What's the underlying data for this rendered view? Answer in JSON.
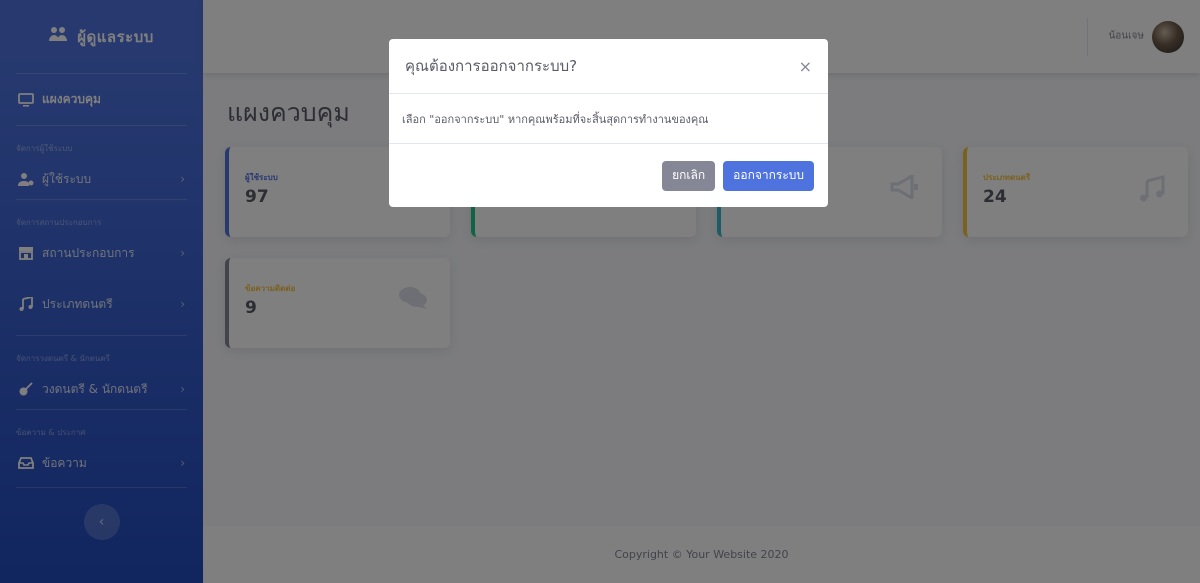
{
  "brand": {
    "icon": "people-icon",
    "label": "ผู้ดูแลระบบ"
  },
  "sidebar": {
    "dashboard": "แผงควบคุม",
    "headings": [
      "จัดการผู้ใช้ระบบ",
      "จัดการสถานประกอบการ",
      "จัดการวงดนตรี & นักดนตรี",
      "ข้อความ & ประกาศ"
    ],
    "items": [
      {
        "label": "ผู้ใช้ระบบ",
        "icon": "user-cog-icon"
      },
      {
        "label": "สถานประกอบการ",
        "icon": "store-icon"
      },
      {
        "label": "ประเภทดนตรี",
        "icon": "music-icon"
      },
      {
        "label": "วงดนตรี & นักดนตรี",
        "icon": "guitar-icon"
      },
      {
        "label": "ข้อความ",
        "icon": "inbox-icon"
      }
    ]
  },
  "topbar": {
    "username": "น้อนเจษ"
  },
  "page": {
    "title": "แผงควบคุม"
  },
  "cards": [
    {
      "label": "ผู้ใช้ระบบ",
      "value": "97",
      "color": "#4e73df",
      "icon": "users-icon"
    },
    {
      "label": "",
      "value": "",
      "color": "#1cc88a",
      "icon": ""
    },
    {
      "label": "",
      "value": "",
      "color": "#36b9cc",
      "icon": "bullhorn-icon"
    },
    {
      "label": "ประเภทดนตรี",
      "value": "24",
      "color": "#f6c23e",
      "icon": "music-icon"
    },
    {
      "label": "ข้อความติดต่อ",
      "value": "9",
      "color": "#858796",
      "icon": "comments-icon"
    }
  ],
  "footer": {
    "text": "Copyright © Your Website 2020"
  },
  "modal": {
    "title": "คุณต้องการออกจากระบบ?",
    "body": "เลือก \"ออกจากระบบ\" หากคุณพร้อมที่จะสิ้นสุดการทำงานของคุณ",
    "cancel": "ยกเลิก",
    "confirm": "ออกจากระบบ"
  }
}
